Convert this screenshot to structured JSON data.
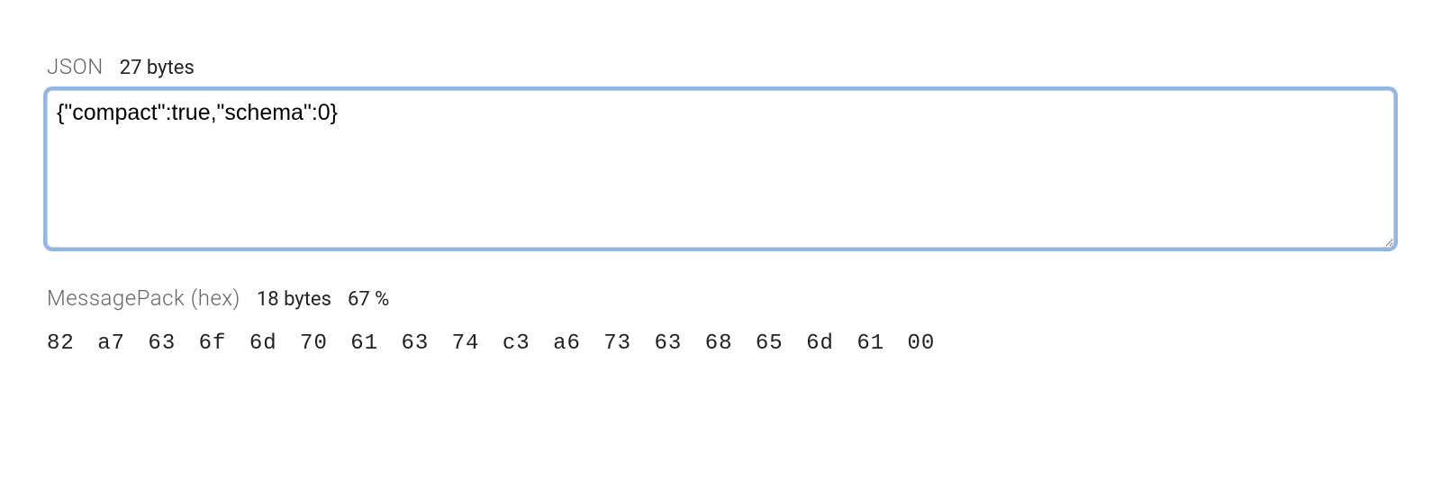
{
  "json_section": {
    "title": "JSON",
    "size_text": "27 bytes",
    "value": "{\"compact\":true,\"schema\":0}"
  },
  "msgpack_section": {
    "title": "MessagePack (hex)",
    "size_text": "18 bytes",
    "ratio_text": "67 %",
    "hex": "82 a7 63 6f 6d 70 61 63 74 c3 a6 73 63 68 65 6d 61 00"
  }
}
